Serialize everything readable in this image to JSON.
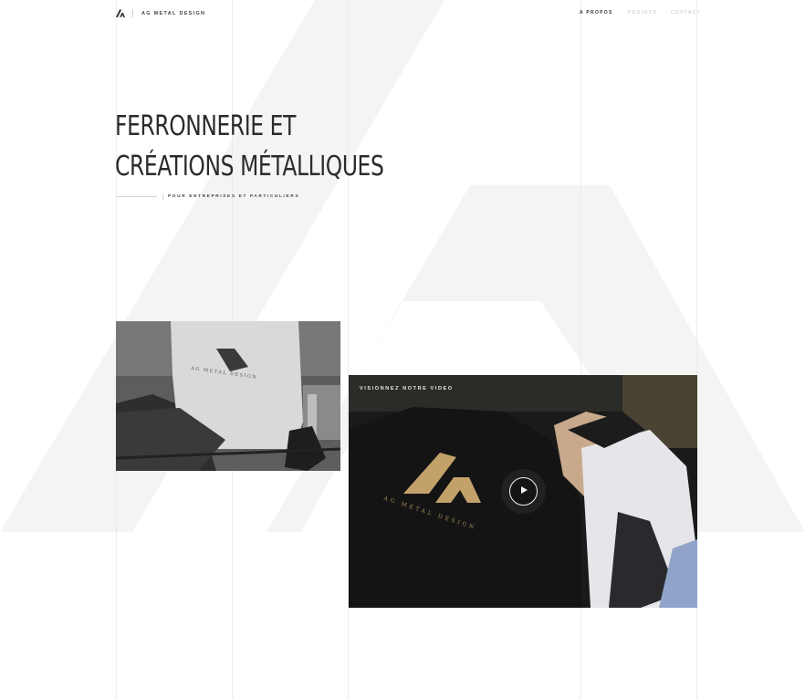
{
  "brand": {
    "name": "AG METAL DESIGN",
    "logo_icon": "ag-monogram-icon",
    "accent_color": "#c2a26a"
  },
  "nav": {
    "items": [
      {
        "label": "A PROPOS",
        "active": true
      },
      {
        "label": "PROJETS",
        "active": false
      },
      {
        "label": "CONTACT",
        "active": false
      }
    ]
  },
  "hero": {
    "title_line1": "FERRONNERIE ET",
    "title_line2": "CRÉATIONS MÉTALLIQUES",
    "subtitle": "POUR ENTREPRISES ET PARTICULIERS"
  },
  "photo_small": {
    "shirt_print": "AG METAL DESIGN"
  },
  "video": {
    "label": "VISIONNEZ NOTRE VIDEO",
    "hoodie_print": "AG METAL DESIGN",
    "play_icon": "play-icon"
  }
}
